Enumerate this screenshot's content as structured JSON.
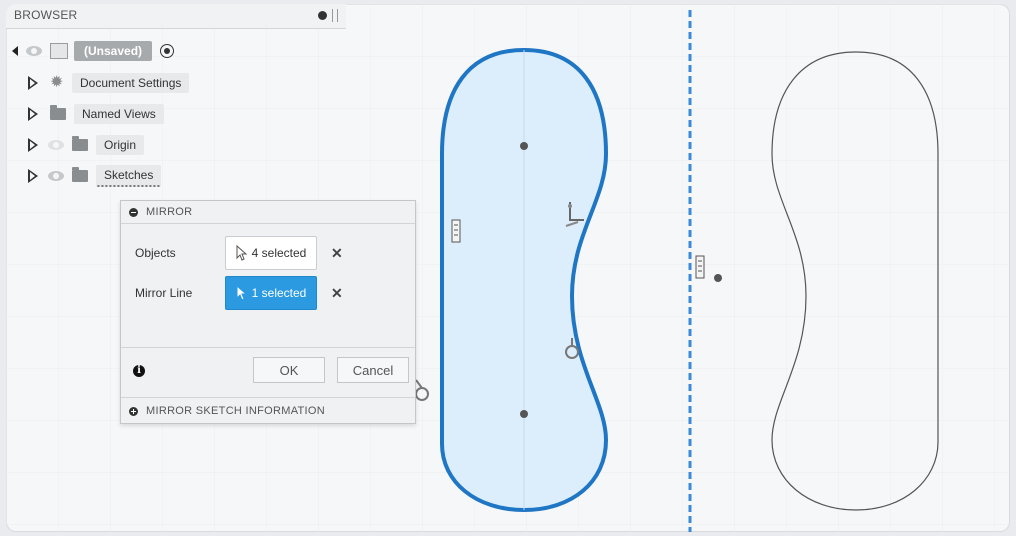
{
  "browser": {
    "title": "BROWSER",
    "document_name": "(Unsaved)",
    "items": [
      {
        "label": "Document Settings",
        "icon": "gear-icon"
      },
      {
        "label": "Named Views",
        "icon": "folder-icon"
      },
      {
        "label": "Origin",
        "icon": "folder-icon"
      },
      {
        "label": "Sketches",
        "icon": "folder-icon"
      }
    ]
  },
  "mirror_dialog": {
    "title": "MIRROR",
    "objects_label": "Objects",
    "objects_value": "4 selected",
    "mirror_line_label": "Mirror Line",
    "mirror_line_value": "1 selected",
    "ok_label": "OK",
    "cancel_label": "Cancel",
    "info_icon": "i",
    "section_title": "MIRROR SKETCH INFORMATION"
  },
  "colors": {
    "accent_blue": "#2b9ae0",
    "profile_stroke": "#1f76c4",
    "profile_fill": "#dceefb",
    "mirror_line": "#3b8ad9"
  }
}
